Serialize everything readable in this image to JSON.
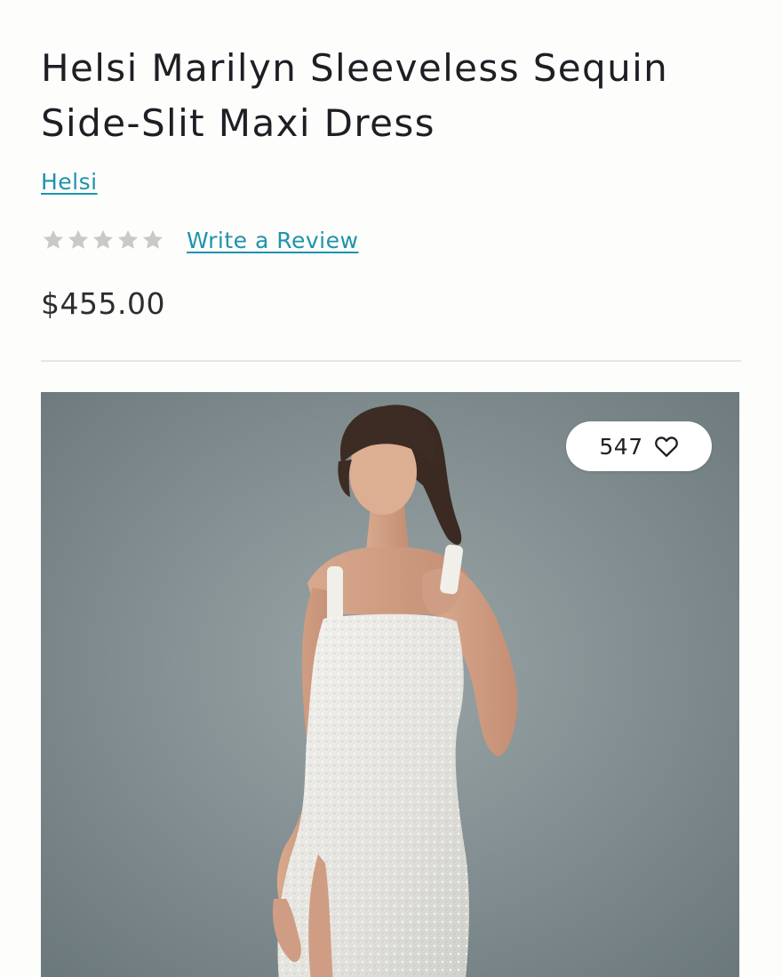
{
  "product": {
    "title": "Helsi Marilyn Sleeveless Sequin Side-Slit Maxi Dress",
    "brand": "Helsi",
    "rating": {
      "value": 0,
      "max": 5,
      "icon": "star-icon",
      "empty_color": "#c9c9c9"
    },
    "write_review_label": "Write a Review",
    "price": "$455.00"
  },
  "image": {
    "likes": "547",
    "like_icon": "heart-icon"
  },
  "colors": {
    "link": "#1f93ad",
    "text": "#1d1f24",
    "background": "#fdfdfb"
  }
}
